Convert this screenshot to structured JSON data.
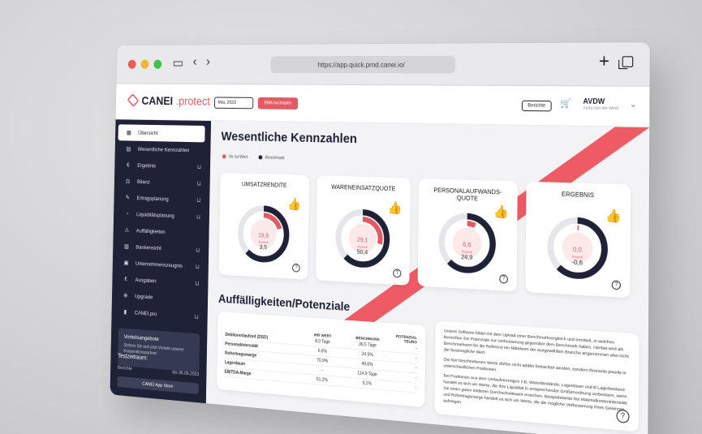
{
  "browser": {
    "url": "https://app.quick.prod.canei.io/"
  },
  "header": {
    "logo_main": "CANEI",
    "logo_accent": ".protect",
    "date": "Mai, 2023",
    "date_button": "BWA hochladen",
    "report_button": "Berichte",
    "user_name": "AVDW",
    "user_sub": "Anna Van der Wind"
  },
  "sidebar": {
    "items": [
      {
        "label": "Übersicht",
        "icon": "grid-icon",
        "cart": false
      },
      {
        "label": "Wesentliche Kennzahlen",
        "icon": "table-icon",
        "cart": false
      },
      {
        "label": "Ergebnis",
        "icon": "euro-icon",
        "cart": true
      },
      {
        "label": "Bilanz",
        "icon": "balance-icon",
        "cart": true
      },
      {
        "label": "Ertragsplanung",
        "icon": "plan-icon",
        "cart": true
      },
      {
        "label": "Liquiditätsplanung",
        "icon": "liquidity-icon",
        "cart": true
      },
      {
        "label": "Auffälligkeiten",
        "icon": "alert-icon",
        "cart": false
      },
      {
        "label": "Bankensicht",
        "icon": "bank-icon",
        "cart": true
      },
      {
        "label": "Unternehmenszeugnis",
        "icon": "certificate-icon",
        "cart": true
      },
      {
        "label": "Ausgaben",
        "icon": "euro-icon",
        "cart": true
      },
      {
        "label": "Upgrade",
        "icon": "upgrade-icon",
        "cart": false
      },
      {
        "label": "CANEI.pro",
        "icon": "chart-icon",
        "cart": true
      }
    ],
    "offer_title": "Vorteilsangebote",
    "offer_text": "Sichern Sie sich jetzt Vorteile unserer Kooperationspartner!",
    "trial_title": "Testzeitraum:",
    "trial_label": "Berichte",
    "trial_until": "bis 06.06.2023",
    "appstore": "CANEI App Store"
  },
  "main": {
    "title": "Wesentliche Kennzahlen",
    "legend_ist": "Ihr Ist-Wert",
    "legend_bench": "Benchmark",
    "kpis": [
      {
        "title": "UMSATZRENDITE",
        "value": "19,9",
        "label": "Prozent",
        "bench": "3,5",
        "ring": 0.2
      },
      {
        "title": "WARENEINSATZQUOTE",
        "value": "29,1",
        "label": "Prozent",
        "bench": "50,4",
        "ring": 0.29
      },
      {
        "title": "PERSONALAUFWANDS-QUOTE",
        "value": "6,6",
        "label": "Prozent",
        "bench": "24,9",
        "ring": 0.07
      },
      {
        "title": "ERGEBNIS",
        "value": "0,0",
        "label": "Prozent",
        "bench": "-0,6",
        "ring": 0.01
      }
    ],
    "section_title": "Auffälligkeiten/Potenziale",
    "table": {
      "headers": [
        "",
        "IHR WERT",
        "BENCHMARK",
        "POTENZIAL TEURO"
      ],
      "rows": [
        [
          "Debitorenlaufzeit (DSO)",
          "8,0 Tage",
          "36,5 Tage",
          "-"
        ],
        [
          "Personalintensität",
          "6,6%",
          "24,9%",
          "-"
        ],
        [
          "Rohertragsmarge",
          "70,9%",
          "49,6%",
          "-"
        ],
        [
          "Lagerdauer",
          "-",
          "114,9 Tage",
          "-"
        ],
        [
          "EBITDA-Marge",
          "61,2%",
          "9,2%",
          "-"
        ]
      ]
    },
    "info_p1": "Unsere Software bildet mit dem Upload einer Benchmarkvergleich und ermittelt, in welchen Bereichen Sie Potenziale zur Verbesserung gegenüber dem Benchmark haben. Hierbei wird als Benchmarkwert für die Referenz ein Mittelwert der ausgewählten Branche angenommen also nicht der bestmögliche Wert.",
    "info_p2": "Die hier beschriebenen Werte dürfen nicht additiv betrachtet werden, sondern ihrerseits jeweils in unterschiedlichen Positionen.",
    "info_p3": "Bei Positionen aus dem Umlaufvermögen z.B. Warenbestände, Lagerdauer und B Lagerbestand handelt es sich um Werte, die Ihre Liquidität in entsprechender Größenordnung verbessern, wenn Sie einen guten mittleren Durchschnittswert erreichen. Beispielsweise bei Materialkostenintensität und Rohertragsmarge handelt es sich um Werte, die die mögliche Verbesserung Ihres Gewinnes aufzeigen.",
    "colors": {
      "accent": "#e25b62",
      "dark": "#1f2237",
      "ring_bg": "#e6e6ea"
    }
  }
}
